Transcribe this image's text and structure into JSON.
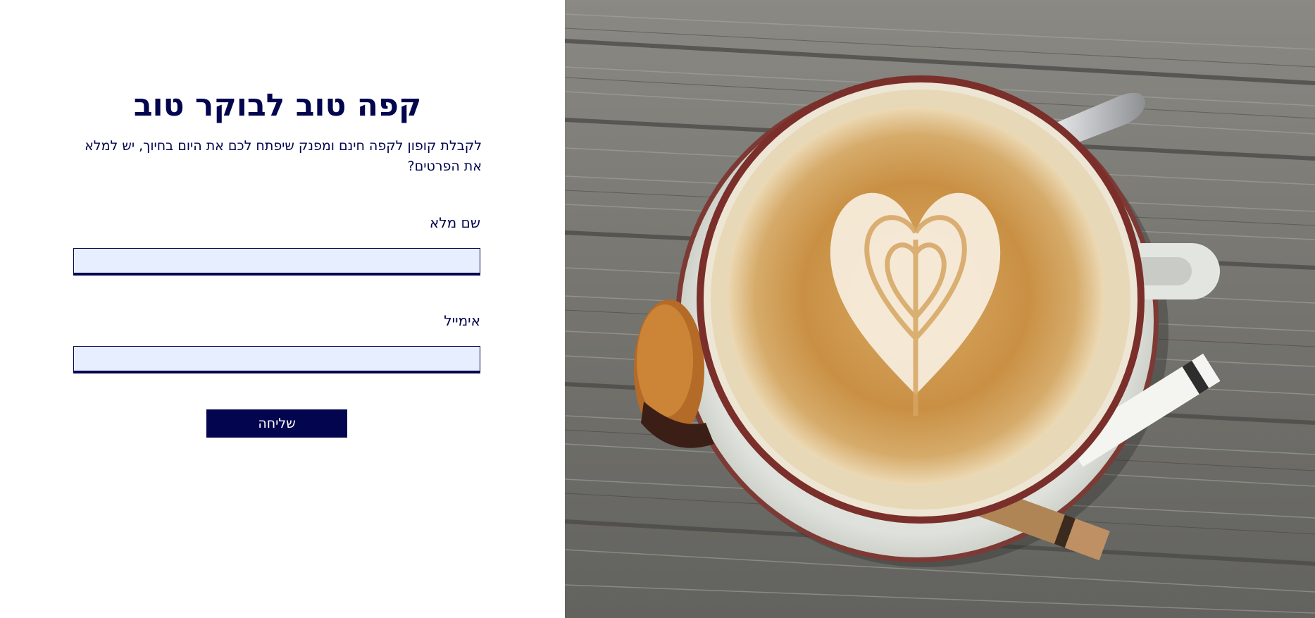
{
  "form": {
    "title": "קפה טוב לבוקר טוב",
    "subtitle": "לקבלת קופון לקפה חינם ומפנק שיפתח לכם את היום בחיוך, יש למלא את הפרטים?",
    "fields": [
      {
        "label": "שם מלא",
        "value": "",
        "placeholder": ""
      },
      {
        "label": "אימייל",
        "value": "",
        "placeholder": ""
      }
    ],
    "submit_label": "שליחה"
  },
  "hero_image": {
    "subject": "latte-art-coffee-cup-on-wooden-table"
  },
  "colors": {
    "primary": "#03054f",
    "input_background": "#e6eeff",
    "page_background": "#ffffff"
  }
}
